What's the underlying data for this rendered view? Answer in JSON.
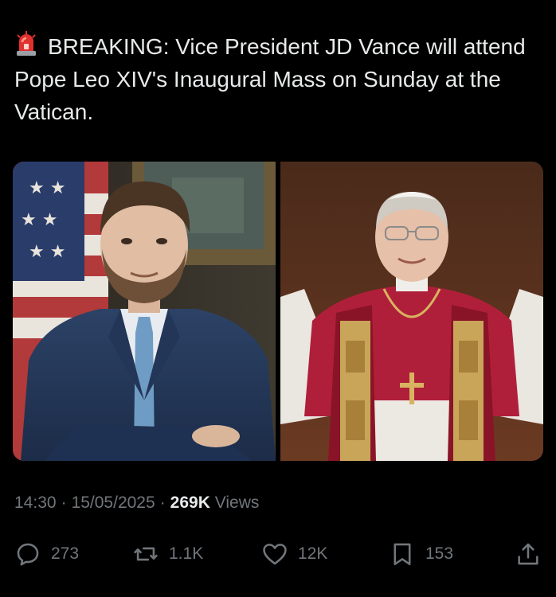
{
  "tweet": {
    "text": "BREAKING: Vice President JD Vance will attend Pope Leo XIV's Inaugural Mass on Sunday at the Vatican.",
    "icon": "police-car-light-icon"
  },
  "meta": {
    "time": "14:30",
    "date": "15/05/2025",
    "views_count": "269K",
    "views_label": "Views"
  },
  "actions": {
    "replies": "273",
    "reposts": "1.1K",
    "likes": "12K",
    "bookmarks": "153"
  },
  "colors": {
    "background": "#000000",
    "text": "#e7e9ea",
    "secondary": "#71767b"
  }
}
